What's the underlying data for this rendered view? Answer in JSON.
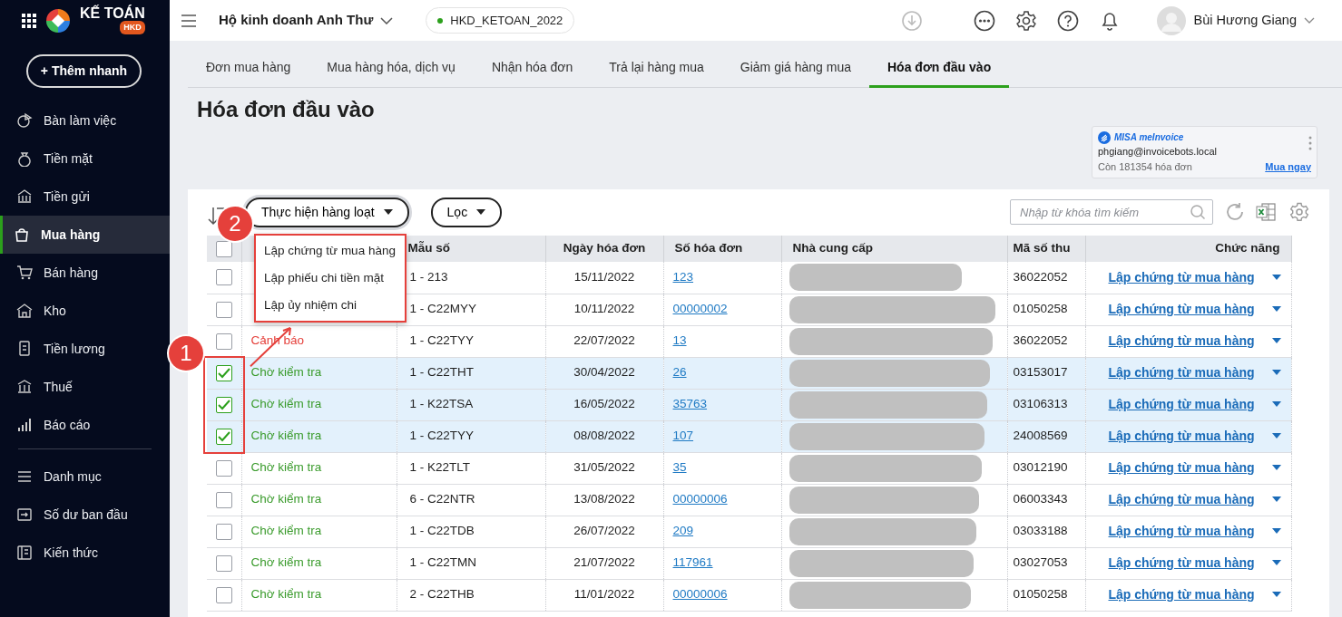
{
  "app": {
    "logo_text": "KẾ TOÁN",
    "logo_badge": "HKD",
    "quick_add": "+ Thêm nhanh"
  },
  "sidebar": {
    "items": [
      {
        "label": "Bàn làm việc",
        "selected": false
      },
      {
        "label": "Tiền mặt",
        "selected": false
      },
      {
        "label": "Tiền gửi",
        "selected": false
      },
      {
        "label": "Mua hàng",
        "selected": true
      },
      {
        "label": "Bán hàng",
        "selected": false
      },
      {
        "label": "Kho",
        "selected": false
      },
      {
        "label": "Tiền lương",
        "selected": false
      },
      {
        "label": "Thuế",
        "selected": false
      },
      {
        "label": "Báo cáo",
        "selected": false
      }
    ],
    "lower_items": [
      {
        "label": "Danh mục",
        "selected": false
      },
      {
        "label": "Số dư ban đầu",
        "selected": false
      },
      {
        "label": "Kiến thức",
        "selected": false
      }
    ]
  },
  "topbar": {
    "company": "Hộ kinh doanh Anh Thư",
    "database": "HKD_KETOAN_2022",
    "user": "Bùi Hương Giang"
  },
  "tabs": [
    {
      "label": "Đơn mua hàng",
      "selected": false
    },
    {
      "label": "Mua hàng hóa, dịch vụ",
      "selected": false
    },
    {
      "label": "Nhận hóa đơn",
      "selected": false
    },
    {
      "label": "Trả lại hàng mua",
      "selected": false
    },
    {
      "label": "Giảm giá hàng mua",
      "selected": false
    },
    {
      "label": "Hóa đơn đầu vào",
      "selected": true
    }
  ],
  "page_title": "Hóa đơn đầu vào",
  "invoice_widget": {
    "brand": "MISA meInvoice",
    "email": "phgiang@invoicebots.local",
    "remaining": "Còn 181354 hóa đơn",
    "action": "Mua ngay"
  },
  "toolbar": {
    "bulk_button": "Thực hiện hàng loạt",
    "filter_button": "Lọc",
    "search": {
      "placeholder": "Nhập từ khóa tìm kiếm"
    }
  },
  "bulk_menu": {
    "open": true,
    "items": [
      "Lập chứng từ mua hàng",
      "Lập phiếu chi tiền mặt",
      "Lập ủy nhiệm chi"
    ]
  },
  "table": {
    "all_selected": false,
    "columns": [
      "",
      "",
      "Mẫu số",
      "Ngày hóa đơn",
      "Số hóa đơn",
      "Nhà cung cấp",
      "Mã số thu",
      "Chức năng"
    ],
    "rows": [
      {
        "selected": false,
        "form": "1 - 213",
        "date": "15/11/2022",
        "number": "123",
        "supplier": {
          "kind": "redacted"
        },
        "tax_code": "36022052",
        "action": "Lập chứng từ mua hàng"
      },
      {
        "selected": false,
        "form": "1 - C22MYY",
        "date": "10/11/2022",
        "number": "00000002",
        "supplier": {
          "kind": "redacted"
        },
        "tax_code": "01050258",
        "action": "Lập chứng từ mua hàng"
      },
      {
        "selected": false,
        "status": {
          "text": "Cảnh báo",
          "color": "#e5403b"
        },
        "form": "1 - C22TYY",
        "date": "22/07/2022",
        "number": "13",
        "supplier": {
          "kind": "redacted"
        },
        "tax_code": "36022052",
        "action": "Lập chứng từ mua hàng"
      },
      {
        "selected": true,
        "status": {
          "text": "Chờ kiểm tra",
          "color": "#3a9b2c"
        },
        "form": "1 - C22THT",
        "date": "30/04/2022",
        "number": "26",
        "supplier": {
          "kind": "redacted"
        },
        "tax_code": "03153017",
        "action": "Lập chứng từ mua hàng"
      },
      {
        "selected": true,
        "status": {
          "text": "Chờ kiểm tra",
          "color": "#3a9b2c"
        },
        "form": "1 - K22TSA",
        "date": "16/05/2022",
        "number": "35763",
        "supplier": {
          "kind": "redacted"
        },
        "tax_code": "03106313",
        "action": "Lập chứng từ mua hàng"
      },
      {
        "selected": true,
        "status": {
          "text": "Chờ kiểm tra",
          "color": "#3a9b2c"
        },
        "form": "1 - C22TYY",
        "date": "08/08/2022",
        "number": "107",
        "supplier": {
          "kind": "redacted"
        },
        "tax_code": "24008569",
        "action": "Lập chứng từ mua hàng"
      },
      {
        "selected": false,
        "status": {
          "text": "Chờ kiểm tra",
          "color": "#3a9b2c"
        },
        "form": "1 - K22TLT",
        "date": "31/05/2022",
        "number": "35",
        "supplier": {
          "kind": "redacted"
        },
        "tax_code": "03012190",
        "action": "Lập chứng từ mua hàng"
      },
      {
        "selected": false,
        "status": {
          "text": "Chờ kiểm tra",
          "color": "#3a9b2c"
        },
        "form": "6 - C22NTR",
        "date": "13/08/2022",
        "number": "00000006",
        "supplier": {
          "kind": "redacted"
        },
        "tax_code": "06003343",
        "action": "Lập chứng từ mua hàng"
      },
      {
        "selected": false,
        "status": {
          "text": "Chờ kiểm tra",
          "color": "#3a9b2c"
        },
        "form": "1 - C22TDB",
        "date": "26/07/2022",
        "number": "209",
        "supplier": {
          "kind": "redacted"
        },
        "tax_code": "03033188",
        "action": "Lập chứng từ mua hàng"
      },
      {
        "selected": false,
        "status": {
          "text": "Chờ kiểm tra",
          "color": "#3a9b2c"
        },
        "form": "1 - C22TMN",
        "date": "21/07/2022",
        "number": "117961",
        "supplier": {
          "kind": "redacted"
        },
        "tax_code": "03027053",
        "action": "Lập chứng từ mua hàng"
      },
      {
        "selected": false,
        "status": {
          "text": "Chờ kiểm tra",
          "color": "#3a9b2c"
        },
        "form": "2 - C22THB",
        "date": "11/01/2022",
        "number": "00000006",
        "supplier": {
          "kind": "redacted"
        },
        "tax_code": "01050258",
        "action": "Lập chứng từ mua hàng"
      }
    ]
  },
  "annotations": [
    {
      "label": "1",
      "kind": "box"
    },
    {
      "label": "2",
      "kind": "pointer"
    }
  ]
}
